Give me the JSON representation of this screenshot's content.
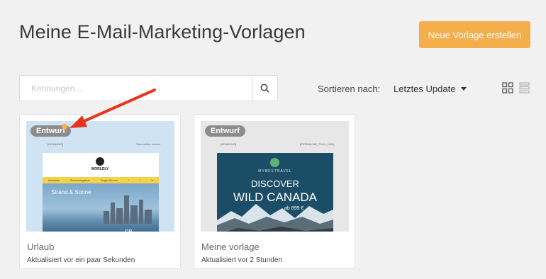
{
  "header": {
    "title": "Meine E-Mail-Marketing-Vorlagen",
    "new_button": "Neue Vorlage erstellen"
  },
  "toolbar": {
    "search_placeholder": "Kennungen...",
    "sort_label": "Sortieren nach:",
    "sort_value": "Letztes Update"
  },
  "cards": [
    {
      "badge": "Entwurf",
      "title": "Urlaub",
      "subtitle": "Aktualisiert vor ein paar Sekunden",
      "thumb": {
        "top_left": "[KENNUNG]",
        "top_right": "View online version",
        "logo": "WORLDLY",
        "nav": [
          "Reiseziele",
          "Sommerangebote",
          "Fragen Sie uns",
          "f",
          "t",
          "in"
        ],
        "headline": "Strand & Sonne",
        "corner_text": "OR"
      }
    },
    {
      "badge": "Entwurf",
      "title": "Meine vorlage",
      "subtitle": "Aktualisiert vor 2 Stunden",
      "thumb": {
        "top_left": "[KENNUNG]",
        "top_right": "[PERMALINK_FULL_LINK]",
        "brand": "MYBESTRAVEL",
        "headline_1": "DISCOVER",
        "headline_2": "WILD CANADA",
        "price": "ab 899 €"
      }
    }
  ],
  "colors": {
    "accent": "#f4ae4b",
    "background": "#f1f1f1",
    "badge": "#8c8c8c",
    "arrow": "#e8341c"
  },
  "icons": [
    "search-icon",
    "grid-view-icon",
    "list-view-icon",
    "chevron-down-icon"
  ]
}
